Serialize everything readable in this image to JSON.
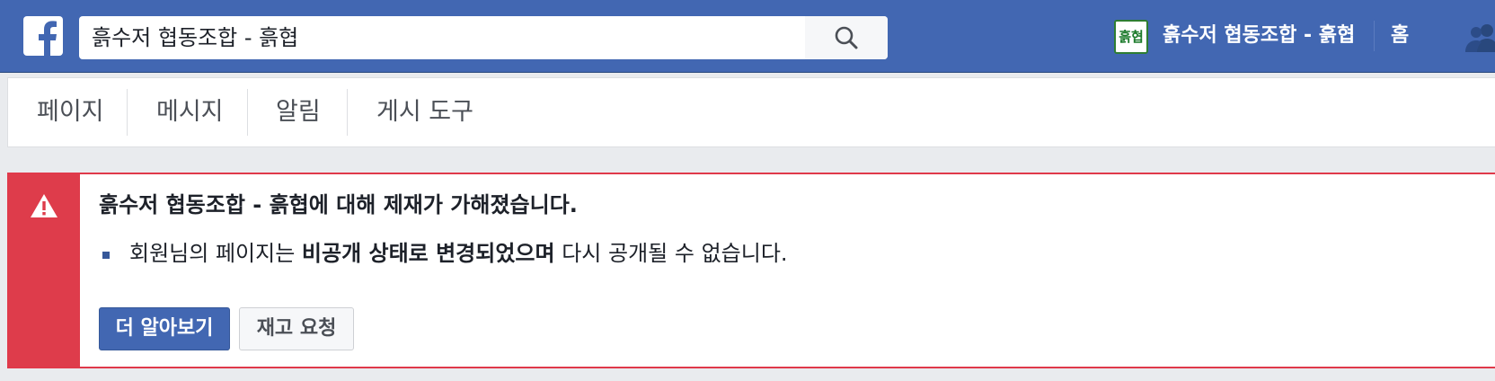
{
  "header": {
    "search_value": "흙수저 협동조합 - 흙협",
    "page_thumb_text": "흙협",
    "page_name": "흙수저 협동조합 - 흙협",
    "home_label": "홈",
    "brand_color": "#4267b2"
  },
  "icons": {
    "logo": "facebook-f-icon",
    "search": "search-icon",
    "friends": "friends-icon",
    "warning": "warning-icon"
  },
  "tabs": [
    {
      "label": "페이지"
    },
    {
      "label": "메시지"
    },
    {
      "label": "알림"
    },
    {
      "label": "게시 도구"
    }
  ],
  "alert": {
    "title": "흙수저 협동조합 - 흙협에 대해 제재가 가해졌습니다.",
    "body_prefix": "회원님의 페이지는 ",
    "body_bold": "비공개 상태로 변경되었으며",
    "body_suffix": " 다시 공개될 수 없습니다.",
    "learn_more_label": "더 알아보기",
    "appeal_label": "재고 요청",
    "accent_color": "#de3c4b"
  }
}
